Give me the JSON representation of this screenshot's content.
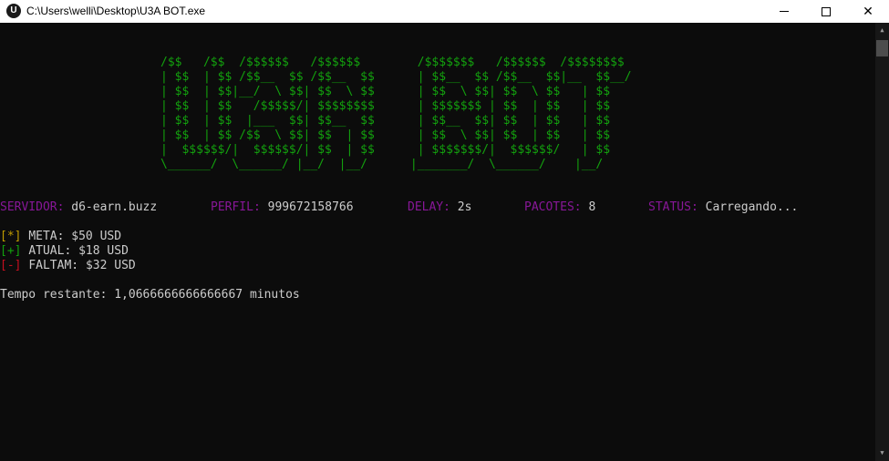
{
  "window": {
    "title": "C:\\Users\\welli\\Desktop\\U3A BOT.exe",
    "app_icon": "console-app-icon",
    "close_glyph": "✕"
  },
  "banner": {
    "lines": [
      "/$$   /$$  /$$$$$$   /$$$$$$        /$$$$$$$   /$$$$$$  /$$$$$$$$",
      "| $$  | $$ /$$__  $$ /$$__  $$      | $$__  $$ /$$__  $$|__  $$__/",
      "| $$  | $$|__/  \\ $$| $$  \\ $$      | $$  \\ $$| $$  \\ $$   | $$",
      "| $$  | $$   /$$$$$/| $$$$$$$$      | $$$$$$$ | $$  | $$   | $$",
      "| $$  | $$  |___  $$| $$__  $$      | $$__  $$| $$  | $$   | $$",
      "| $$  | $$ /$$  \\ $$| $$  | $$      | $$  \\ $$| $$  | $$   | $$",
      "|  $$$$$$/|  $$$$$$/| $$  | $$      | $$$$$$$/|  $$$$$$/   | $$",
      "\\______/  \\______/ |__/  |__/      |_______/  \\______/    |__/"
    ]
  },
  "status": {
    "servidor": {
      "label": "SERVIDOR:",
      "value": "d6-earn.buzz"
    },
    "perfil": {
      "label": "PERFIL:",
      "value": "999672158766"
    },
    "delay": {
      "label": "DELAY:",
      "value": "2s"
    },
    "pacotes": {
      "label": "PACOTES:",
      "value": "8"
    },
    "status": {
      "label": "STATUS:",
      "value": "Carregando..."
    }
  },
  "stats": {
    "meta": {
      "bracket_open": "[",
      "symbol": "*",
      "bracket_close": "]",
      "label": "META:",
      "value": "$50 USD"
    },
    "atual": {
      "bracket_open": "[",
      "symbol": "+",
      "bracket_close": "]",
      "label": "ATUAL:",
      "value": "$18 USD"
    },
    "faltam": {
      "bracket_open": "[",
      "symbol": "-",
      "bracket_close": "]",
      "label": "FALTAM:",
      "value": "$32 USD"
    }
  },
  "remaining": {
    "label": "Tempo restante:",
    "value": "1,0666666666666667",
    "unit": "minutos"
  },
  "colors": {
    "banner": "#13a10e",
    "label": "#881798",
    "meta_bracket": "#c19c00",
    "atual_bracket": "#13a10e",
    "faltam_bracket": "#c50f1f",
    "background": "#0c0c0c",
    "text": "#cccccc"
  }
}
